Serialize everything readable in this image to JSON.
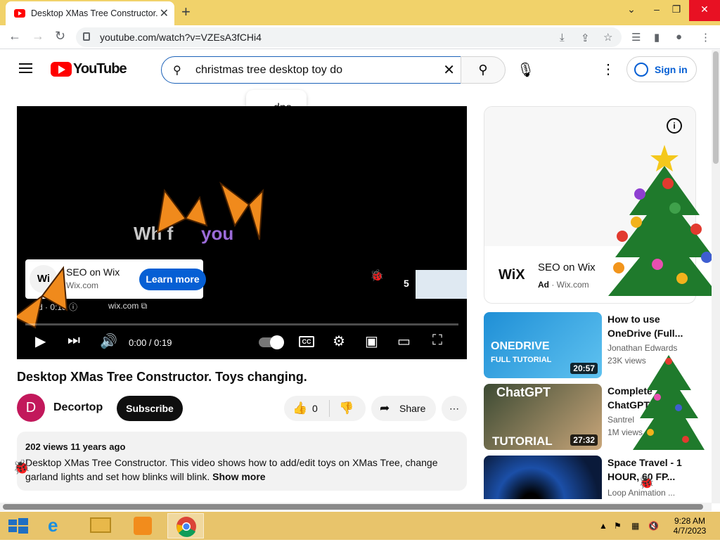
{
  "browser": {
    "tab_title": "Desktop XMas Tree Constructor.",
    "url": "youtube.com/watch?v=VZEsA3fCHi4"
  },
  "youtube": {
    "logo_text": "YouTube",
    "search_query": "christmas tree desktop toy do",
    "suggestion": "... dps",
    "signin_label": "Sign in"
  },
  "player": {
    "overlay_text_1": "Wh  f",
    "overlay_text_2": "you",
    "ad_title": "SEO on Wix",
    "ad_domain": "Wix.com",
    "ad_logo": "Wi",
    "learn_more": "Learn more",
    "ad_meta": "Ad · 0:18 ⓘ",
    "ad_link": "wix.com ⧉",
    "skip_count": "5",
    "time": "0:00 / 0:19",
    "cc": "CC",
    "progress": 0.0
  },
  "video": {
    "title": "Desktop XMas Tree Constructor. Toys changing.",
    "channel_initial": "D",
    "channel_name": "Decortop",
    "subscribe": "Subscribe",
    "likes": "0",
    "share": "Share",
    "stats": "202 views  11 years ago",
    "description": "Desktop XMas Tree Constructor. This video shows how to add/edit toys on XMas Tree, change garland lights and set how blinks will blink.",
    "show_more": "Show more"
  },
  "sidebar": {
    "ad": {
      "logo": "WiX",
      "name": "SEO on Wix",
      "badge": "Ad",
      "domain": "· Wix.com",
      "info": "i"
    },
    "recommendations": [
      {
        "title": "How to use OneDrive (Full...",
        "channel": "Jonathan Edwards",
        "views": "23K views",
        "duration": "20:57",
        "thumb_a": "ONEDRIVE",
        "thumb_b": "FULL TUTORIAL"
      },
      {
        "title": "Complete ChatGPT...",
        "channel": "Santrel",
        "views": "1M views",
        "duration": "27:32",
        "thumb_a": "ChatGPT",
        "thumb_b": "TUTORIAL"
      },
      {
        "title": "Space Travel - 1 HOUR, 60 FP...",
        "channel": "Loop Animation ...",
        "views": "",
        "duration": "",
        "thumb_a": "",
        "thumb_b": ""
      }
    ]
  },
  "taskbar": {
    "time": "9:28 AM",
    "date": "4/7/2023"
  },
  "colors": {
    "youtube_red": "#ff0000",
    "link_blue": "#065fd4",
    "tab_strip": "#f1d26a",
    "taskbar": "#e8c46b"
  }
}
